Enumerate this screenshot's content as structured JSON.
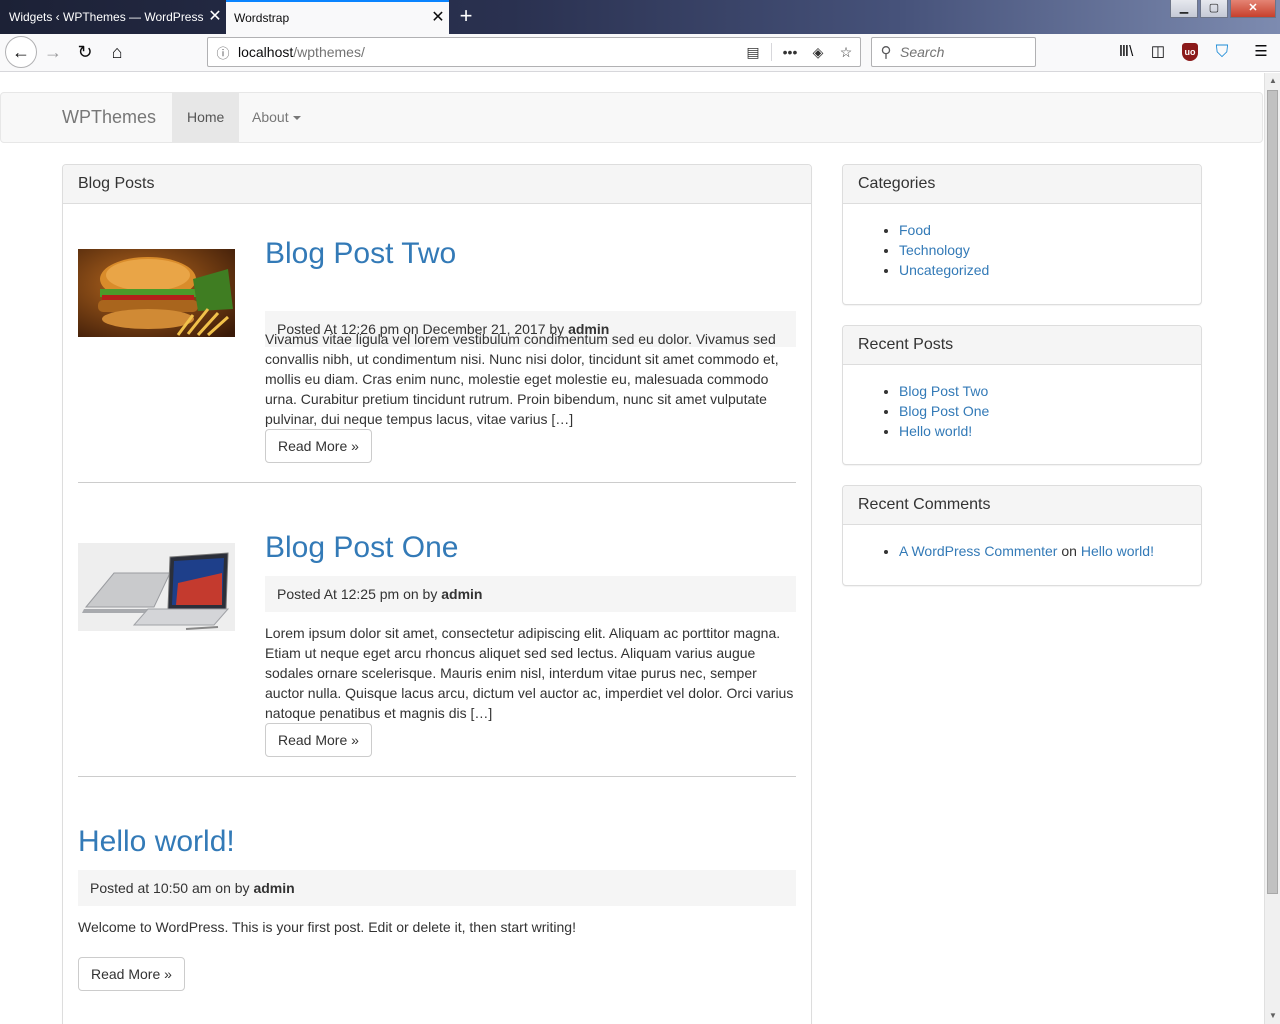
{
  "browser": {
    "tabs": [
      {
        "title": "Widgets ‹ WPThemes — WordPress",
        "close": "✕",
        "active": false
      },
      {
        "title": "Wordstrap",
        "close": "✕",
        "active": true
      }
    ],
    "new_tab": "+",
    "window_buttons": {
      "minimize": "▁",
      "maximize": "▢",
      "close": "✕"
    },
    "nav": {
      "back": "←",
      "forward": "→",
      "reload": "↻",
      "home": "⌂"
    },
    "url": {
      "host": "localhost",
      "path": "/wpthemes/"
    },
    "url_icons": {
      "info": "ⓘ",
      "reader": "▤",
      "more": "•••",
      "pocket": "◈",
      "bookmark": "☆"
    },
    "search": {
      "placeholder": "Search",
      "icon": "⚲"
    },
    "toolbar_icons": {
      "library": "Ⅲ\\",
      "sidebar": "◫",
      "ublock": "uo",
      "shield": "⛉",
      "menu": "☰"
    }
  },
  "site": {
    "brand": "WPThemes",
    "nav": [
      {
        "label": "Home",
        "active": true
      },
      {
        "label": "About",
        "dropdown": true
      }
    ]
  },
  "main": {
    "heading": "Blog Posts",
    "posts": [
      {
        "title": "Blog Post Two",
        "meta_prefix": "Posted At 12:26 pm on December 21, 2017 by",
        "author": "admin",
        "excerpt": "Vivamus vitae ligula vel lorem vestibulum condimentum sed eu dolor. Vivamus sed convallis nibh, ut condimentum nisi. Nunc nisi dolor, tincidunt sit amet commodo et, mollis eu diam. Cras enim nunc, molestie eget molestie eu, malesuada commodo urna. Curabitur pretium tincidunt rutrum. Proin bibendum, nunc sit amet vulputate pulvinar, dui neque tempus lacus, vitae varius […]",
        "read_more": "Read More »",
        "image": "burger-photo"
      },
      {
        "title": "Blog Post One",
        "meta_prefix": "Posted At 12:25 pm on by",
        "author": "admin",
        "excerpt": "Lorem ipsum dolor sit amet, consectetur adipiscing elit. Aliquam ac porttitor magna. Etiam ut neque eget arcu rhoncus aliquet sed sed lectus. Aliquam varius augue sodales ornare scelerisque. Mauris enim nisl, interdum vitae purus nec, semper auctor nulla. Quisque lacus arcu, dictum vel auctor ac, imperdiet vel dolor. Orci varius natoque penatibus et magnis dis […]",
        "read_more": "Read More »",
        "image": "laptop-photo"
      },
      {
        "title": "Hello world!",
        "meta_prefix": "Posted at 10:50 am on by",
        "author": "admin",
        "excerpt": "Welcome to WordPress. This is your first post. Edit or delete it, then start writing!",
        "read_more": "Read More »"
      }
    ]
  },
  "sidebar": {
    "categories": {
      "heading": "Categories",
      "items": [
        "Food",
        "Technology",
        "Uncategorized"
      ]
    },
    "recent_posts": {
      "heading": "Recent Posts",
      "items": [
        "Blog Post Two",
        "Blog Post One",
        "Hello world!"
      ]
    },
    "recent_comments": {
      "heading": "Recent Comments",
      "author": "A WordPress Commenter",
      "on": "on",
      "post": "Hello world!"
    }
  },
  "colors": {
    "link": "#337ab7",
    "panel_heading_bg": "#f5f5f5",
    "navbar_bg": "#f8f8f8",
    "tab_accent": "#0a84ff"
  }
}
